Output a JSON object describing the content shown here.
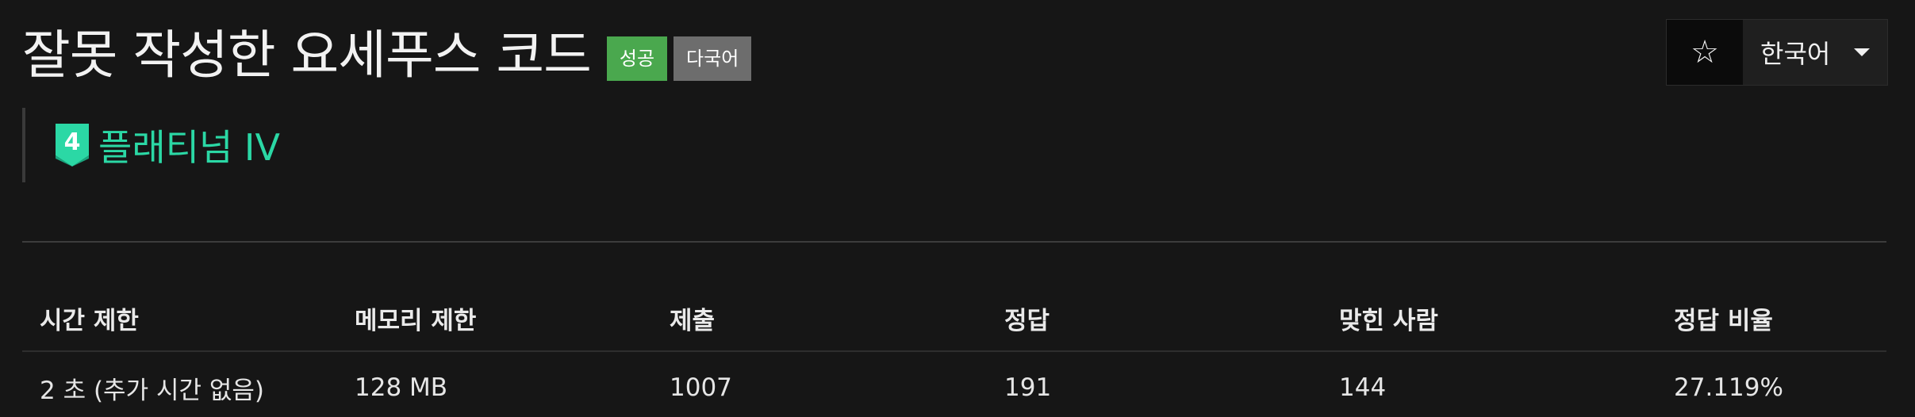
{
  "problem": {
    "title": "잘못 작성한 요세푸스 코드",
    "badges": {
      "success": "성공",
      "multilang": "다국어"
    },
    "tier": {
      "number": "4",
      "label": "플래티넘 IV",
      "color": "#2bd8a5"
    }
  },
  "controls": {
    "star_icon": "star-icon",
    "star_glyph": "☆",
    "language": "한국어"
  },
  "stats": {
    "headers": [
      "시간 제한",
      "메모리 제한",
      "제출",
      "정답",
      "맞힌 사람",
      "정답 비율"
    ],
    "values": [
      "2 초 (추가 시간 없음)",
      "128 MB",
      "1007",
      "191",
      "144",
      "27.119%"
    ]
  },
  "colors": {
    "background": "#161616",
    "success": "#4aa84e",
    "multilang": "#6d6d6d",
    "tier": "#2bd8a5"
  }
}
